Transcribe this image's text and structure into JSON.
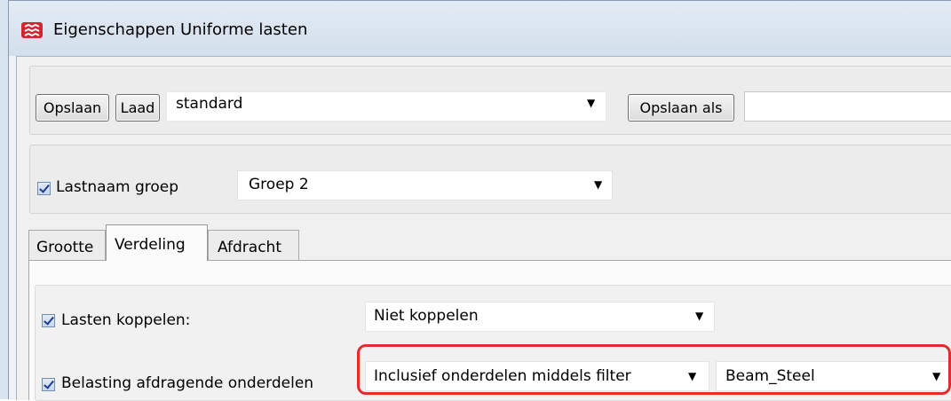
{
  "window": {
    "title": "Eigenschappen Uniforme lasten",
    "app_icon": "tekla-app-icon"
  },
  "toolbar": {
    "save_label": "Opslaan",
    "load_label": "Laad",
    "preset_value": "standard",
    "save_as_label": "Opslaan als",
    "save_as_value": ""
  },
  "load_group": {
    "checkbox_checked": true,
    "label": "Lastnaam groep",
    "value": "Groep 2"
  },
  "tabs": [
    {
      "label": "Grootte",
      "active": false
    },
    {
      "label": "Verdeling",
      "active": true
    },
    {
      "label": "Afdracht",
      "active": false
    }
  ],
  "distribution": {
    "couple": {
      "checked": true,
      "label": "Lasten koppelen:",
      "value": "Niet koppelen"
    },
    "bearing": {
      "checked": true,
      "label": "Belasting afdragende onderdelen",
      "mode_value": "Inclusief onderdelen middels filter",
      "filter_value": "Beam_Steel"
    }
  },
  "colors": {
    "highlight": "#e32d2d",
    "titlebar": "#dce6f1"
  }
}
